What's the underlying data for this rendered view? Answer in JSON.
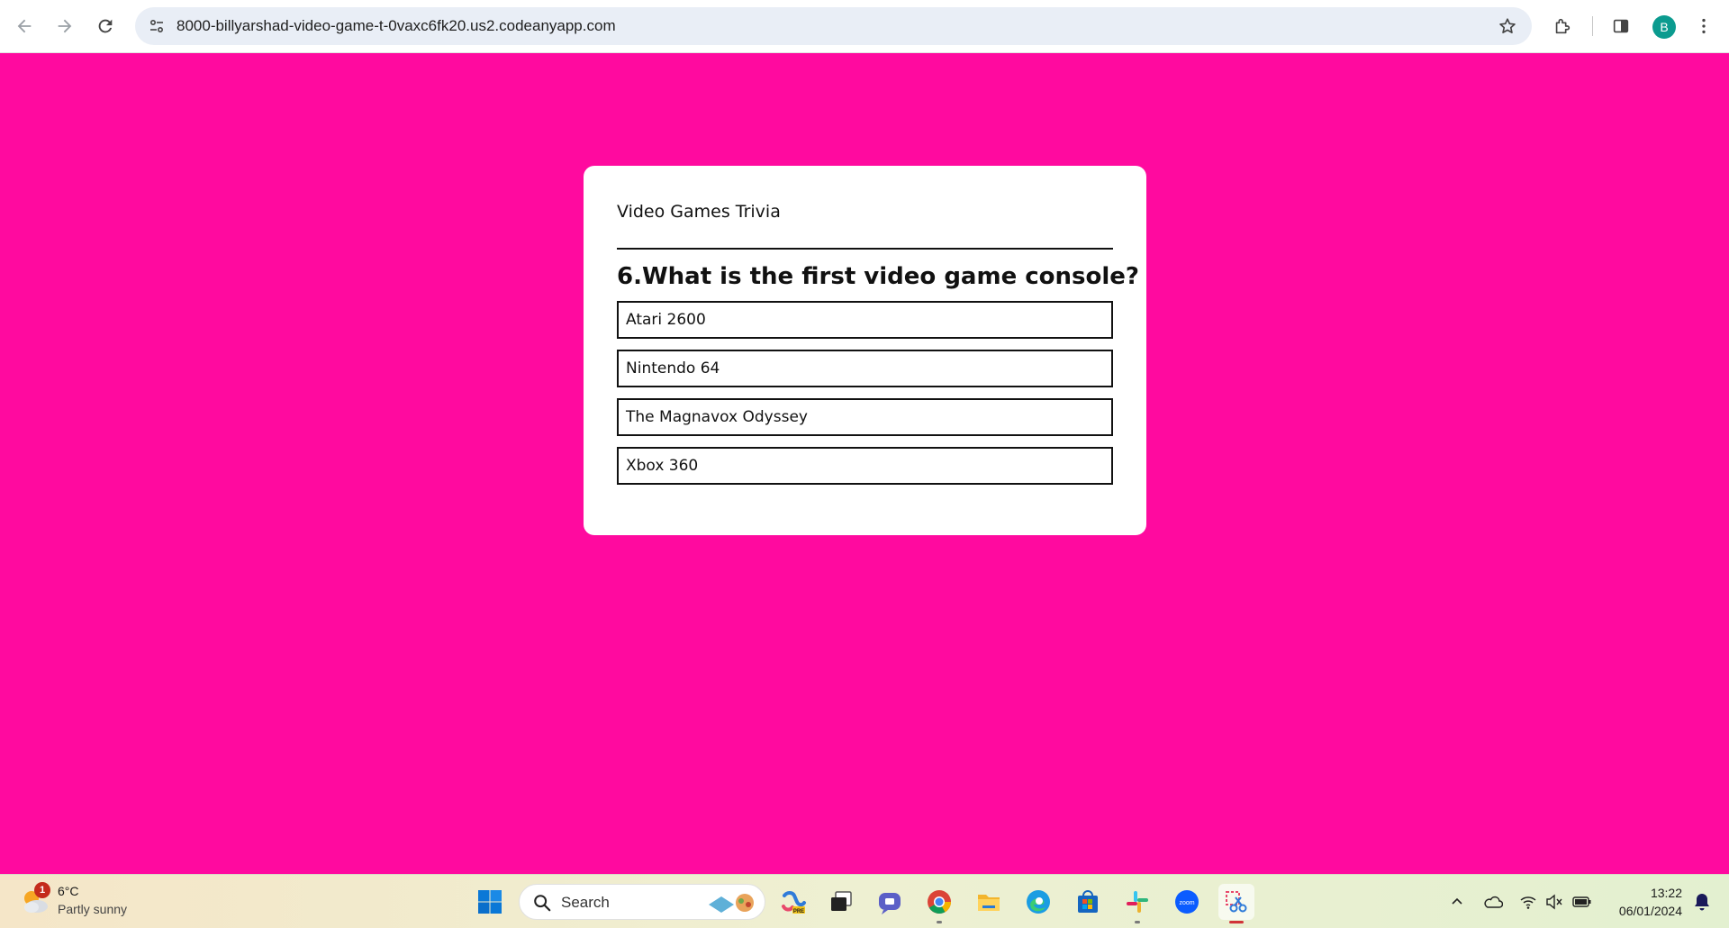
{
  "browser": {
    "url": "8000-billyarshad-video-game-t-0vaxc6fk20.us2.codeanyapp.com",
    "profile_initial": "B"
  },
  "quiz": {
    "title": "Video Games Trivia",
    "question": "6.What is the first video game console?",
    "answers": [
      "Atari 2600",
      "Nintendo 64",
      "The Magnavox Odyssey",
      "Xbox 360"
    ]
  },
  "taskbar": {
    "weather_temp": "6°C",
    "weather_desc": "Partly sunny",
    "weather_badge": "1",
    "search_placeholder": "Search",
    "time": "13:22",
    "date": "06/01/2024"
  },
  "colors": {
    "page_background": "#ff0a9f",
    "card_background": "#ffffff"
  }
}
